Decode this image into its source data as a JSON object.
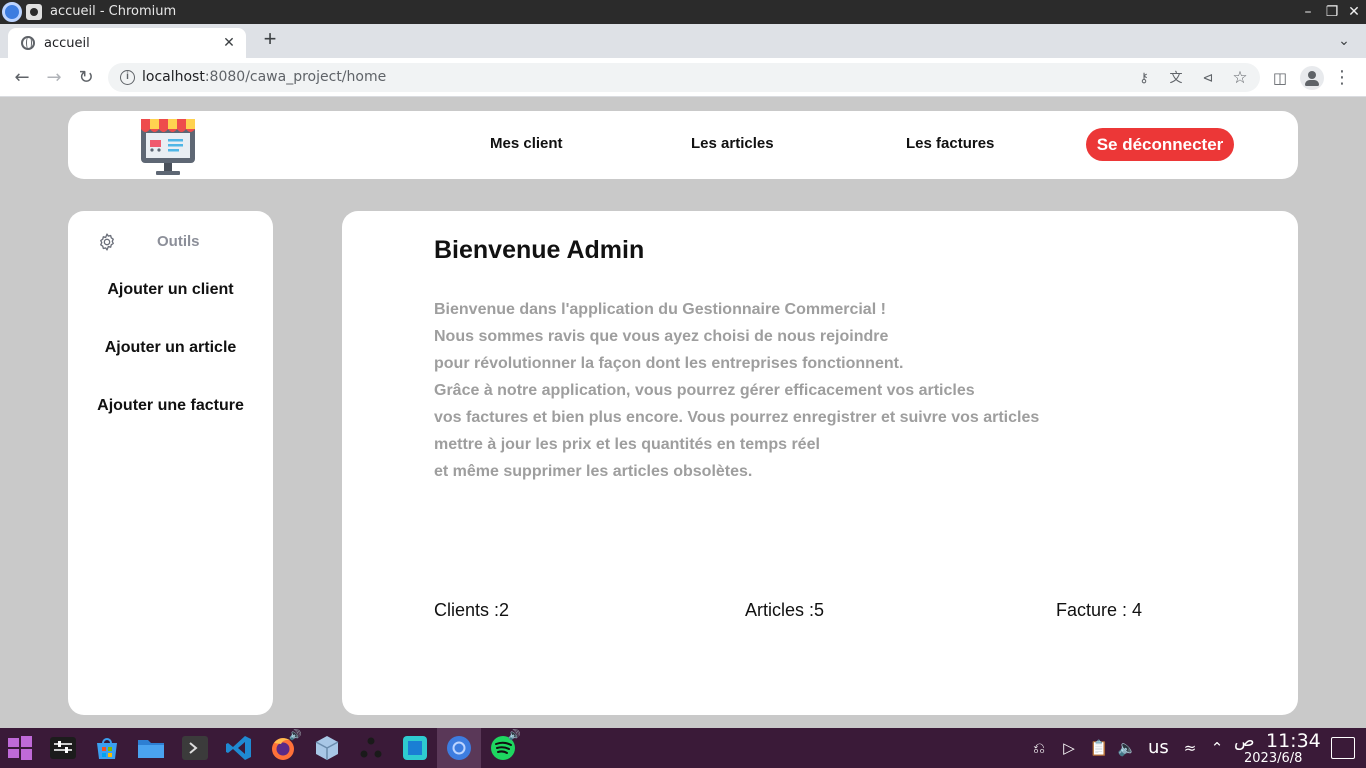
{
  "window": {
    "title": "accueil - Chromium"
  },
  "browser": {
    "tab_title": "accueil",
    "url_host": "localhost",
    "url_rest": ":8080/cawa_project/home"
  },
  "navbar": {
    "links": [
      "Mes client",
      "Les articles",
      "Les factures"
    ],
    "logout_label": "Se déconnecter"
  },
  "sidebar": {
    "header": "Outils",
    "items": [
      "Ajouter un client",
      "Ajouter un article",
      "Ajouter une facture"
    ]
  },
  "main": {
    "heading": "Bienvenue Admin",
    "intro_lines": [
      "Bienvenue dans l'application du Gestionnaire Commercial !",
      "Nous sommes ravis que vous ayez choisi de nous rejoindre",
      "pour révolutionner la façon dont les entreprises fonctionnent.",
      "Grâce à notre application, vous pourrez gérer efficacement vos articles",
      "vos factures et bien plus encore. Vous pourrez enregistrer et suivre vos articles",
      "mettre à jour les prix et les quantités en temps réel",
      "et même supprimer les articles obsolètes."
    ],
    "stats": {
      "clients": "Clients :2",
      "articles": "Articles :5",
      "factures": "Facture : 4"
    }
  },
  "taskbar": {
    "keyboard_layout": "us",
    "time": "11:34",
    "period": "ص",
    "date": "2023/6/8"
  },
  "colors": {
    "page_background": "#c9c9c9",
    "logout_button": "#ec3737",
    "intro_text": "#9e9e9e",
    "taskbar": "#3a1a38"
  }
}
